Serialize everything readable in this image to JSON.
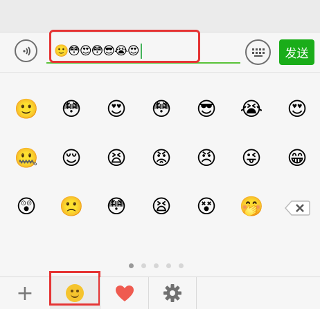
{
  "input_bar": {
    "entered_text": "🙂😳😍😳😎😭😍",
    "voice_icon": "voice-waves-icon",
    "keyboard_icon": "keyboard-icon",
    "send_label": "发送",
    "send_color": "#1aad19"
  },
  "emoji_grid": {
    "rows": [
      [
        "🙂",
        "😳",
        "😍",
        "😳",
        "😎",
        "😭",
        "😍"
      ],
      [
        "🤐",
        "😌",
        "😫",
        "😡",
        "😠",
        "😜",
        "😁"
      ],
      [
        "😲",
        "🙁",
        "😳",
        "😫",
        "😵",
        "🤭"
      ]
    ],
    "delete_icon": "backspace-icon"
  },
  "pager": {
    "pages": 5,
    "active_index": 0
  },
  "tabs": [
    {
      "id": "more",
      "icon": "plus-icon",
      "label": "+"
    },
    {
      "id": "emoji",
      "icon": "smiley-icon",
      "selected": true
    },
    {
      "id": "favorites",
      "icon": "heart-icon"
    },
    {
      "id": "settings",
      "icon": "gear-icon"
    }
  ],
  "accent_colors": {
    "send": "#1aad19",
    "input_underline": "#58c238",
    "annotation": "#e53434"
  }
}
